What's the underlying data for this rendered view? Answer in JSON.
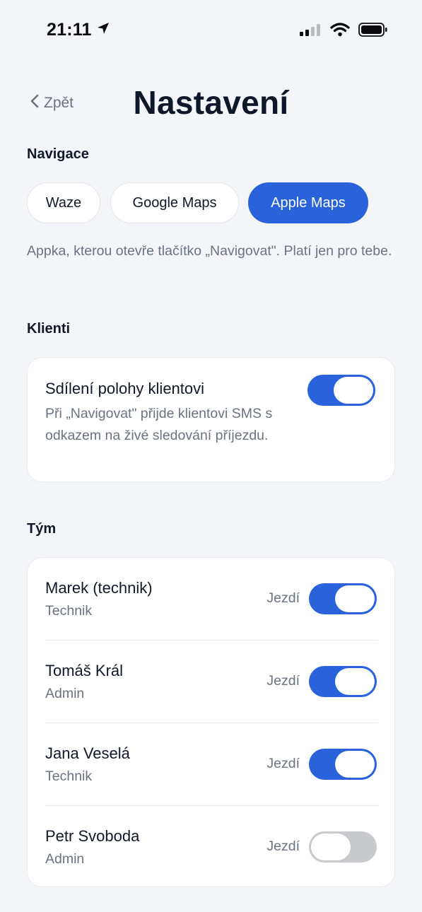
{
  "status": {
    "time": "21:11",
    "icons": [
      "location-arrow-icon",
      "cellular-signal-icon",
      "wifi-icon",
      "battery-icon"
    ]
  },
  "header": {
    "back_label": "Zpět",
    "title": "Nastavení"
  },
  "navigation": {
    "section_label": "Navigace",
    "options": [
      {
        "label": "Waze",
        "selected": false
      },
      {
        "label": "Google Maps",
        "selected": false
      },
      {
        "label": "Apple Maps",
        "selected": true
      }
    ],
    "helper": "Appka, kterou otevře tlačítko „Navigovat\". Platí jen pro tebe."
  },
  "clients": {
    "section_label": "Klienti",
    "location_sharing": {
      "title": "Sdílení polohy klientovi",
      "description": "Při „Navigovat\" přijde klientovi SMS s odkazem na živé sledování příjezdu.",
      "enabled": true
    }
  },
  "team": {
    "section_label": "Tým",
    "members": [
      {
        "name": "Marek (technik)",
        "role": "Technik",
        "drives_label": "Jezdí",
        "drives": true
      },
      {
        "name": "Tomáš Král",
        "role": "Admin",
        "drives_label": "Jezdí",
        "drives": true
      },
      {
        "name": "Jana Veselá",
        "role": "Technik",
        "drives_label": "Jezdí",
        "drives": true
      },
      {
        "name": "Petr Svoboda",
        "role": "Admin",
        "drives_label": "Jezdí",
        "drives": false
      }
    ]
  },
  "colors": {
    "accent": "#2a62db",
    "toggle_off": "#c9cacd",
    "background": "#f3f5f8",
    "muted_text": "#6b7280"
  }
}
